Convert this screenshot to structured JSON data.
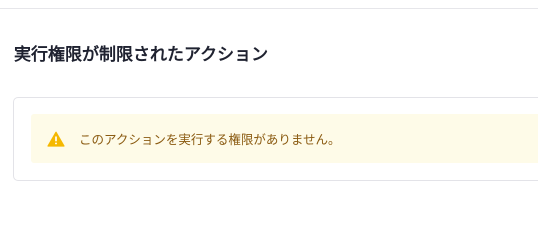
{
  "page": {
    "title": "実行権限が制限されたアクション"
  },
  "alert": {
    "icon": "warning-icon",
    "message": "このアクションを実行する権限がありません。",
    "colors": {
      "background": "#fefbe8",
      "icon": "#f5b800",
      "text": "#8a5a10"
    }
  }
}
